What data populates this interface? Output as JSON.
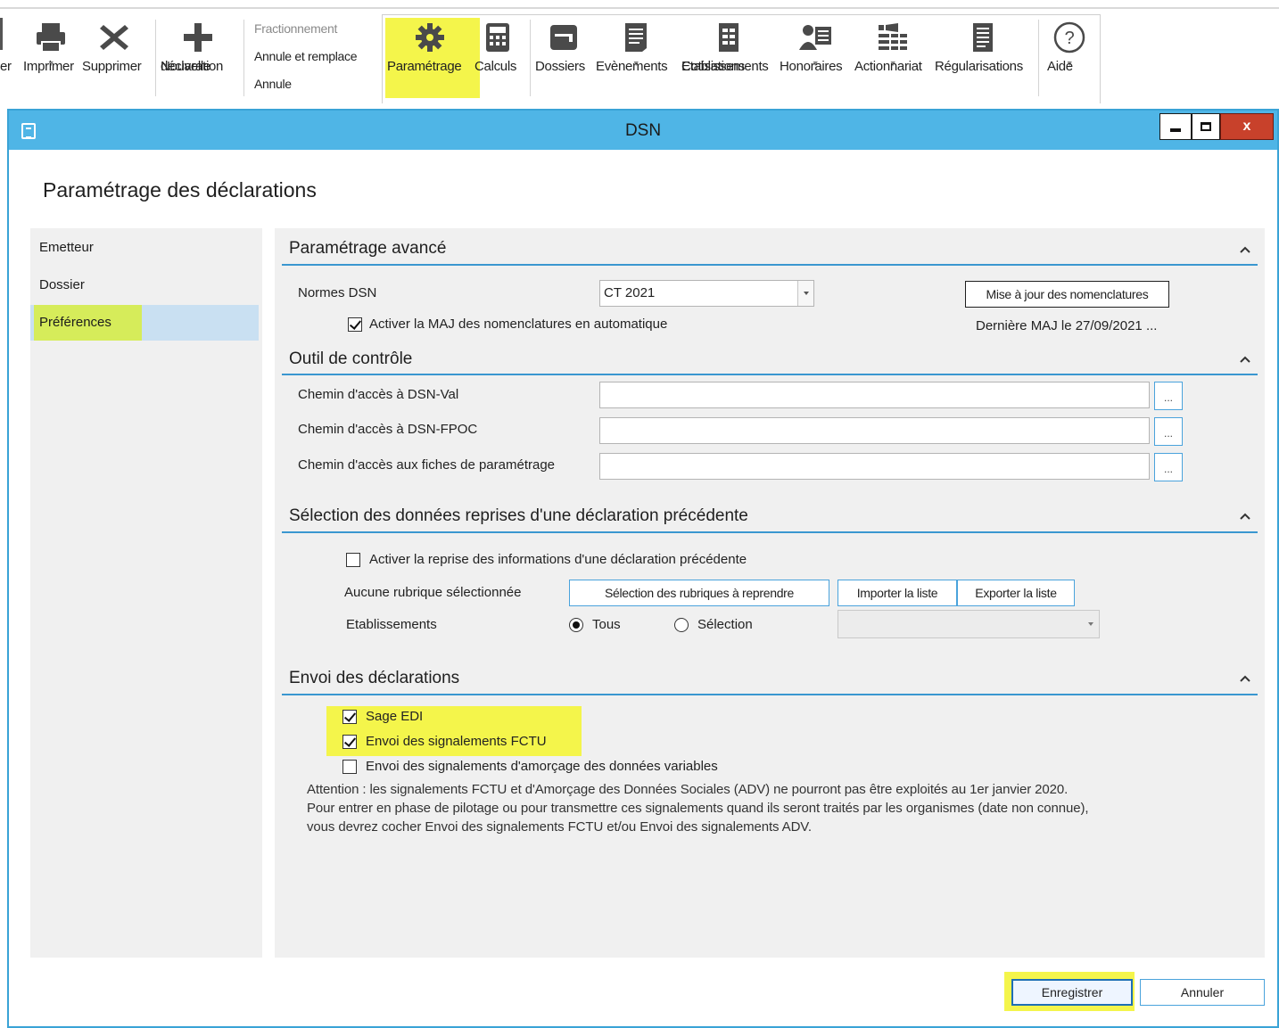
{
  "ribbon": {
    "partial_label": "er",
    "print": "Imprimer",
    "delete": "Supprimer",
    "new_decl_line1": "Nouvelle",
    "new_decl_line2": "déclaration",
    "split": "Fractionnement",
    "replace": "Annule et remplace",
    "cancel_decl": "Annule",
    "settings": "Paramétrage",
    "calcs": "Calculs",
    "folders": "Dossiers",
    "events": "Evènements",
    "contrib_line1": "Cotisations",
    "contrib_line2": "Etablissements",
    "fees": "Honoraires",
    "shareholding": "Actionnariat",
    "adjustments": "Régularisations",
    "help": "Aide"
  },
  "window": {
    "title": "DSN",
    "close_glyph": "x"
  },
  "page_title": "Paramétrage des déclarations",
  "nav": {
    "items": [
      "Emetteur",
      "Dossier",
      "Préférences"
    ],
    "selected": "Préférences"
  },
  "advanced": {
    "title": "Paramétrage avancé",
    "norms_label": "Normes DSN",
    "norms_value": "CT 2021",
    "update_button": "Mise à jour des nomenclatures",
    "auto_update_label": "Activer la MAJ des nomenclatures en automatique",
    "auto_update_checked": true,
    "last_update": "Dernière MAJ le 27/09/2021 ..."
  },
  "control": {
    "title": "Outil de contrôle",
    "path_val_label": "Chemin d'accès à DSN-Val",
    "path_val_value": "",
    "path_fpoc_label": "Chemin d'accès à DSN-FPOC",
    "path_fpoc_value": "",
    "path_sheets_label": "Chemin d'accès aux fiches de paramétrage",
    "path_sheets_value": "",
    "browse": "..."
  },
  "selection": {
    "title": "Sélection des données reprises d'une déclaration précédente",
    "enable_label": "Activer la reprise des informations d'une déclaration précédente",
    "enable_checked": false,
    "none_selected": "Aucune rubrique sélectionnée",
    "select_button": "Sélection des rubriques à reprendre",
    "import_button": "Importer la liste",
    "export_button": "Exporter la liste",
    "establishments_label": "Etablissements",
    "radio_all": "Tous",
    "radio_selection": "Sélection",
    "radio_value": "Tous",
    "combo_value": ""
  },
  "sending": {
    "title": "Envoi des déclarations",
    "sage_edi": "Sage EDI",
    "sage_edi_checked": true,
    "fctu": "Envoi des signalements FCTU",
    "fctu_checked": true,
    "adv": "Envoi des signalements d'amorçage des données variables",
    "adv_checked": false,
    "note_line1": "Attention : les signalements FCTU et d'Amorçage des Données Sociales (ADV) ne pourront pas être exploités au 1er janvier 2020.",
    "note_line2": "Pour entrer en phase de pilotage ou pour transmettre ces signalements quand ils seront traités par les organismes (date non connue),",
    "note_line3": "vous devrez cocher Envoi des signalements FCTU et/ou Envoi des signalements ADV."
  },
  "footer": {
    "save": "Enregistrer",
    "cancel": "Annuler"
  },
  "colors": {
    "titlebar": "#4fb5e6",
    "accent_line": "#3a97d0",
    "highlight": "#f4f54b",
    "close": "#c8412b"
  }
}
